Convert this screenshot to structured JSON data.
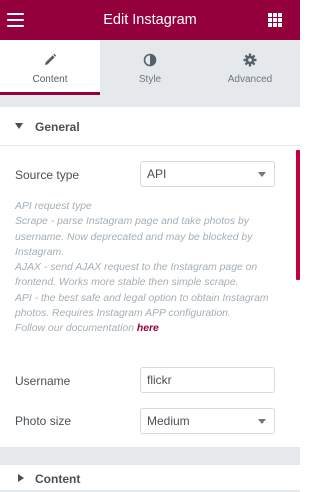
{
  "header": {
    "title": "Edit Instagram",
    "menu_icon": "hamburger-icon",
    "apps_icon": "grid-icon",
    "bg_color": "#93003c"
  },
  "tabs": [
    {
      "label": "Content",
      "icon": "pencil-icon",
      "active": true
    },
    {
      "label": "Style",
      "icon": "half-circle-icon",
      "active": false
    },
    {
      "label": "Advanced",
      "icon": "gear-icon",
      "active": false
    }
  ],
  "general": {
    "title": "General",
    "source_type": {
      "label": "Source type",
      "value": "API"
    },
    "description": {
      "lines": [
        "API request type",
        "Scrape - parse Instagram page and take photos by username. Now deprecated and may be blocked by Instagram.",
        "AJAX - send AJAX request to the Instagram page on frontend. Works more stable then simple scrape.",
        "API - the best safe and legal option to obtain Instagram photos. Requires Instagram APP configuration."
      ],
      "follow_text": "Follow our documentation",
      "link_text": "here"
    },
    "username": {
      "label": "Username",
      "value": "flickr"
    },
    "photo_size": {
      "label": "Photo size",
      "value": "Medium"
    }
  },
  "content_section": {
    "title": "Content"
  }
}
